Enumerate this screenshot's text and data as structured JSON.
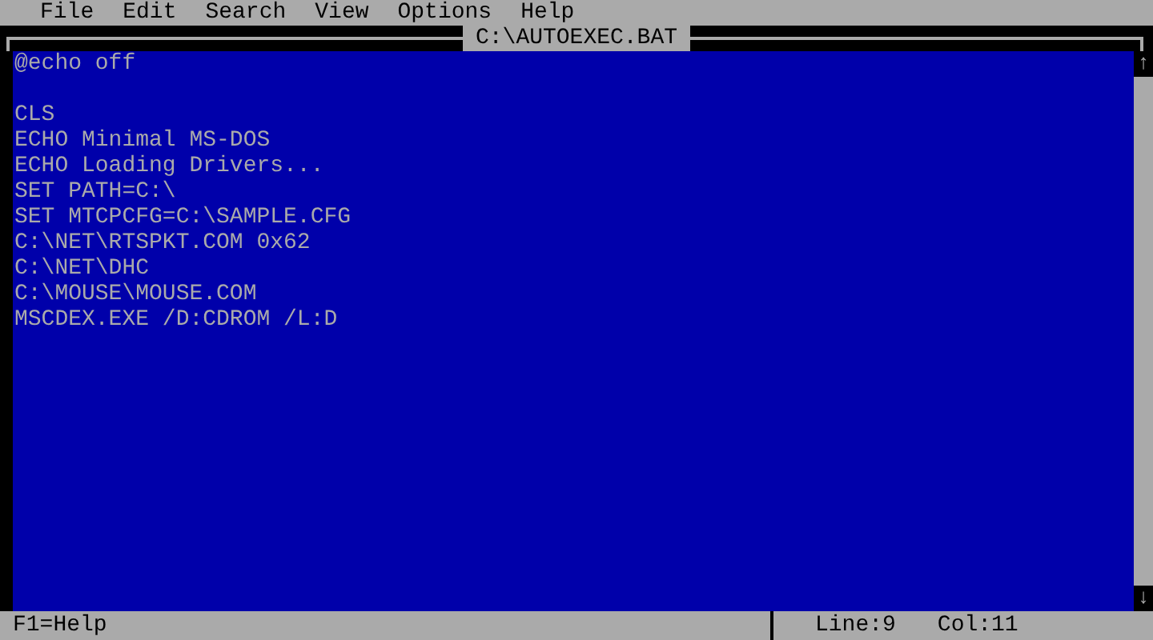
{
  "menu_bar": {
    "items": [
      "File",
      "Edit",
      "Search",
      "View",
      "Options",
      "Help"
    ]
  },
  "window": {
    "title": "C:\\AUTOEXEC.BAT"
  },
  "editor": {
    "lines": [
      {
        "kind": "text",
        "text": "@echo off"
      },
      {
        "kind": "blank"
      },
      {
        "kind": "text",
        "text": "CLS"
      },
      {
        "kind": "text",
        "text": "ECHO Minimal MS-DOS"
      },
      {
        "kind": "text",
        "text": "ECHO Loading Drivers..."
      },
      {
        "kind": "text",
        "text": "SET PATH=C:\\"
      },
      {
        "kind": "text",
        "text": "SET MTCPCFG=C:\\SAMPLE.CFG"
      },
      {
        "kind": "text",
        "text": "C:\\NET\\RTSPKT.COM 0x62"
      },
      {
        "kind": "text",
        "text": "C:\\NET\\DHC"
      },
      {
        "kind": "text",
        "text": "C:\\MOUSE\\MOUSE.COM"
      },
      {
        "kind": "text",
        "text": "MSCDEX.EXE /D:CDROM /L:D"
      }
    ]
  },
  "scrollbar": {
    "up": "↑",
    "down": "↓"
  },
  "status_bar": {
    "help": "F1=Help",
    "line": "Line:9",
    "col": "Col:11"
  }
}
